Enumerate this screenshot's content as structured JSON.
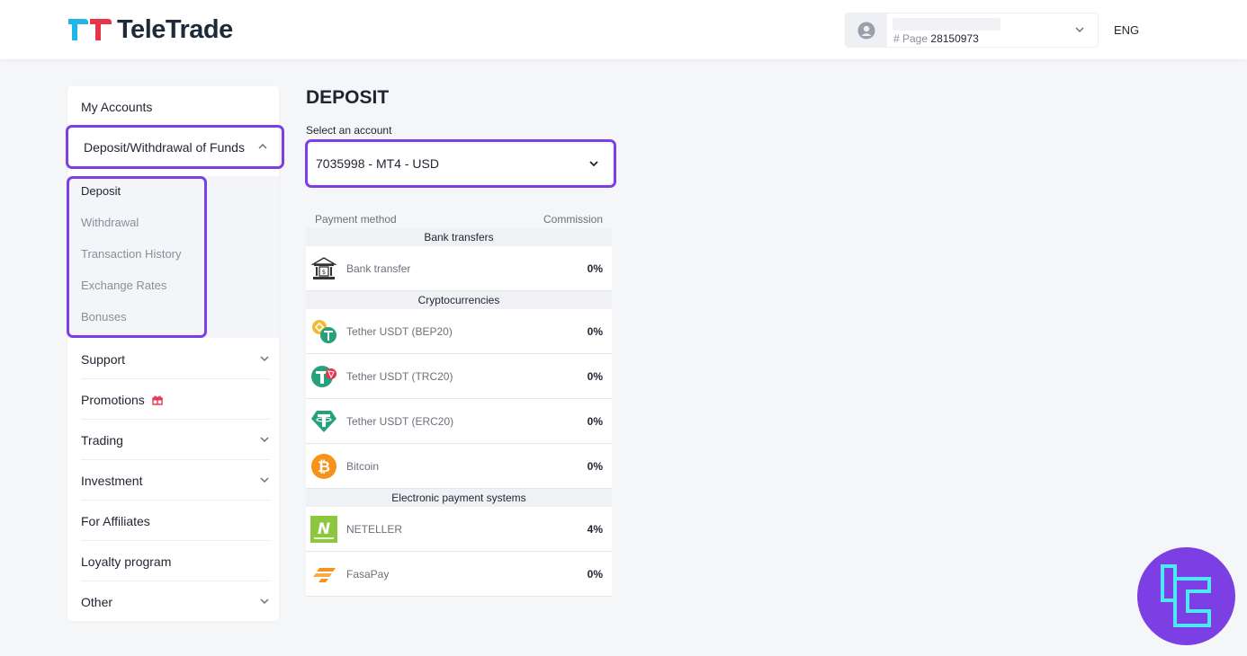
{
  "header": {
    "brand": "TeleTrade",
    "account_page_label": "# Page",
    "account_page_number": "28150973",
    "language": "ENG"
  },
  "sidebar": {
    "items": [
      {
        "label": "My Accounts"
      },
      {
        "label": "Deposit/Withdrawal of Funds"
      },
      {
        "label": "Support"
      },
      {
        "label": "Promotions"
      },
      {
        "label": "Trading"
      },
      {
        "label": "Investment"
      },
      {
        "label": "For Affiliates"
      },
      {
        "label": "Loyalty program"
      },
      {
        "label": "Other"
      }
    ],
    "sub_items": [
      {
        "label": "Deposit"
      },
      {
        "label": "Withdrawal"
      },
      {
        "label": "Transaction History"
      },
      {
        "label": "Exchange Rates"
      },
      {
        "label": "Bonuses"
      }
    ]
  },
  "main": {
    "title": "DEPOSIT",
    "select_label": "Select an account",
    "selected_account": "7035998 - MT4 - USD",
    "table_headers": {
      "method": "Payment method",
      "commission": "Commission"
    },
    "categories": [
      "Bank transfers",
      "Cryptocurrencies",
      "Electronic payment systems"
    ],
    "methods": [
      {
        "name": "Bank transfer",
        "commission": "0%",
        "icon": "bank-icon"
      },
      {
        "name": "Tether USDT (BEP20)",
        "commission": "0%",
        "icon": "tether-bep20-icon"
      },
      {
        "name": "Tether USDT (TRC20)",
        "commission": "0%",
        "icon": "tether-trc20-icon"
      },
      {
        "name": "Tether USDT (ERC20)",
        "commission": "0%",
        "icon": "tether-erc20-icon"
      },
      {
        "name": "Bitcoin",
        "commission": "0%",
        "icon": "bitcoin-icon"
      },
      {
        "name": "NETELLER",
        "commission": "4%",
        "icon": "neteller-icon"
      },
      {
        "name": "FasaPay",
        "commission": "0%",
        "icon": "fasapay-icon"
      }
    ]
  },
  "colors": {
    "highlight": "#7b3fe4",
    "brand_red": "#e8354a",
    "brand_blue": "#1fb6e8",
    "tether_green": "#26a17b",
    "bitcoin_orange": "#f7931a",
    "neteller_green": "#8dc63f"
  }
}
